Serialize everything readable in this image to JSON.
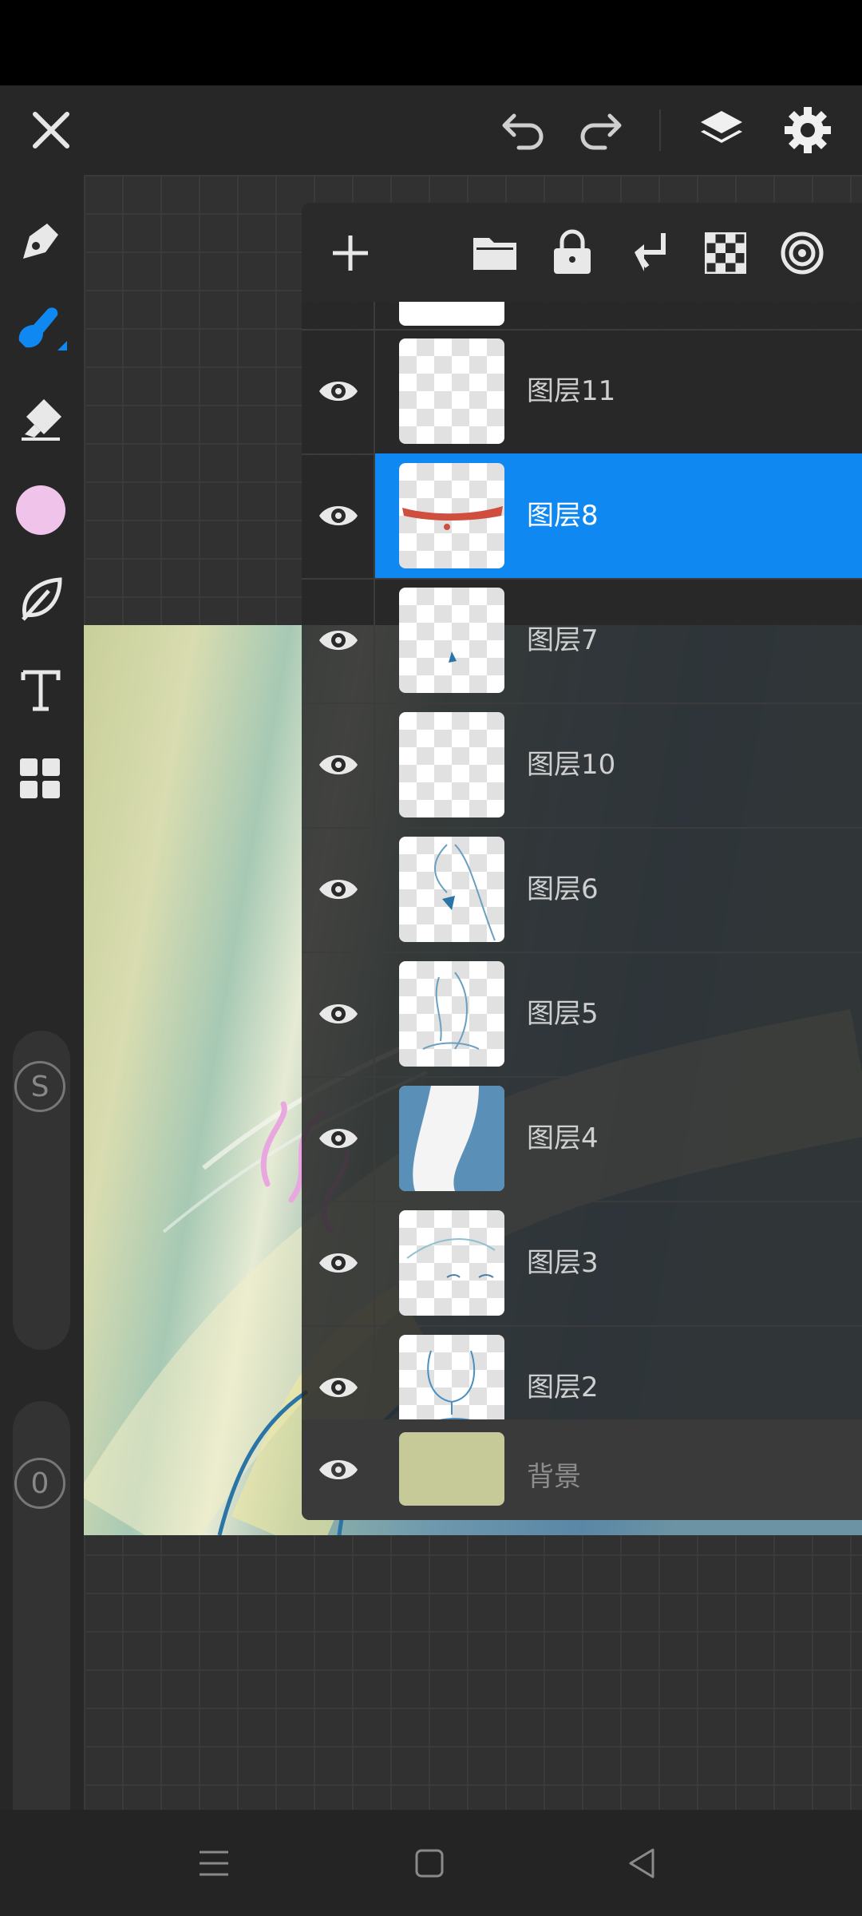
{
  "toolbar": {
    "close_icon": "close-icon",
    "undo_icon": "undo-icon",
    "redo_icon": "redo-icon",
    "layers_icon": "layers-icon",
    "settings_icon": "gear-icon"
  },
  "tools": [
    "pen-icon",
    "brush-icon",
    "eraser-icon",
    "color-swatch",
    "leaf-icon",
    "text-icon",
    "grid-icon"
  ],
  "current_color": "#f0c4ea",
  "sliders": {
    "size_label": "S",
    "opacity_label": "0"
  },
  "layer_panel": {
    "actions": [
      "add-icon",
      "folder-icon",
      "lock-icon",
      "merge-down-icon",
      "transparency-icon",
      "target-icon"
    ],
    "layers": [
      {
        "name": "图层11",
        "selected": false
      },
      {
        "name": "图层8",
        "selected": true
      },
      {
        "name": "图层7",
        "selected": false
      },
      {
        "name": "图层10",
        "selected": false
      },
      {
        "name": "图层6",
        "selected": false
      },
      {
        "name": "图层5",
        "selected": false
      },
      {
        "name": "图层4",
        "selected": false
      },
      {
        "name": "图层3",
        "selected": false
      },
      {
        "name": "图层2",
        "selected": false
      }
    ],
    "background": {
      "name": "背景",
      "color": "#c6c998"
    }
  },
  "navbar": {
    "menu_icon": "menu-icon",
    "home_icon": "home-icon",
    "back_icon": "back-icon"
  },
  "accent": "#1088f2"
}
